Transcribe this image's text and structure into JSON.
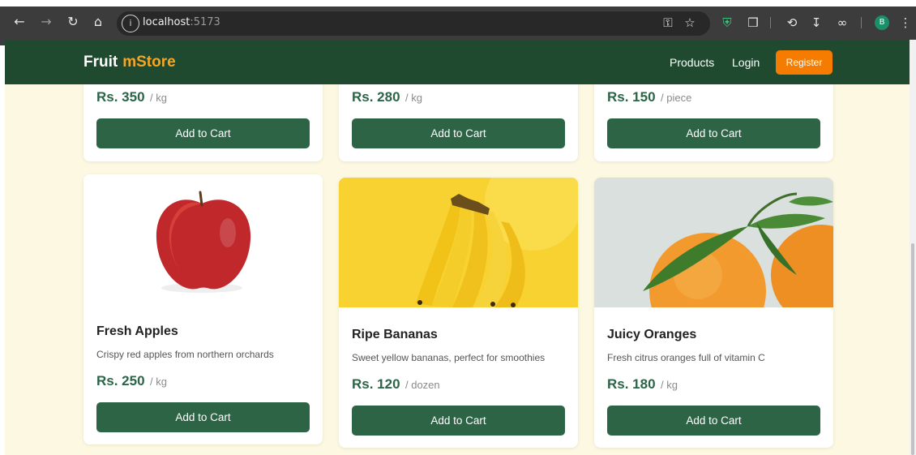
{
  "browser": {
    "url_host": "localhost",
    "url_port": ":5173",
    "profile_initial": "B"
  },
  "site": {
    "logo_primary": "Fruit",
    "logo_accent": "mStore",
    "nav": {
      "products": "Products",
      "login": "Login",
      "register": "Register"
    }
  },
  "colors": {
    "header_bg": "#1f4a30",
    "accent": "#f5a623",
    "register_bg": "#f57c00",
    "button_bg": "#2d6446",
    "page_bg": "#fdf8e1"
  },
  "top_row": [
    {
      "price": "Rs. 350",
      "unit": "/ kg",
      "button": "Add to Cart"
    },
    {
      "price": "Rs. 280",
      "unit": "/ kg",
      "button": "Add to Cart"
    },
    {
      "price": "Rs. 150",
      "unit": "/ piece",
      "button": "Add to Cart"
    }
  ],
  "products": [
    {
      "title": "Fresh Apples",
      "desc": "Crispy red apples from northern orchards",
      "price": "Rs. 250",
      "unit": "/ kg",
      "button": "Add to Cart",
      "image": "apple-image"
    },
    {
      "title": "Ripe Bananas",
      "desc": "Sweet yellow bananas, perfect for smoothies",
      "price": "Rs. 120",
      "unit": "/ dozen",
      "button": "Add to Cart",
      "image": "banana-image"
    },
    {
      "title": "Juicy Oranges",
      "desc": "Fresh citrus oranges full of vitamin C",
      "price": "Rs. 180",
      "unit": "/ kg",
      "button": "Add to Cart",
      "image": "orange-image"
    }
  ]
}
